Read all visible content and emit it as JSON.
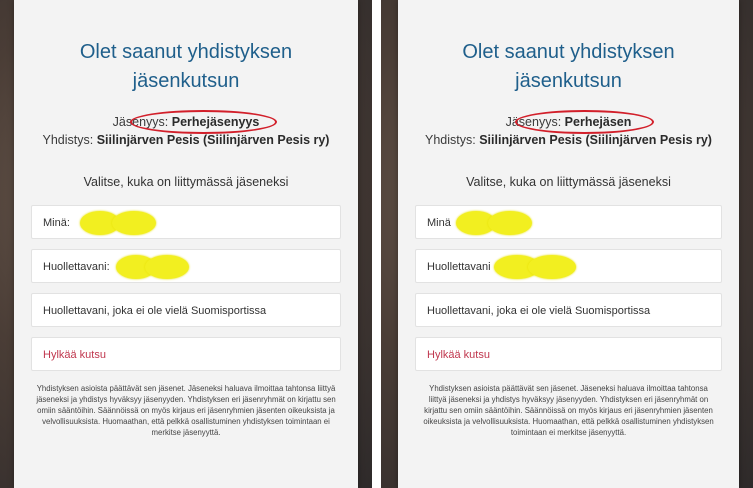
{
  "panels": [
    {
      "title_line1": "Olet saanut yhdistyksen",
      "title_line2": "jäsenkutsun",
      "membership_label": "Jäsenyys:",
      "membership_value": "Perhejäsenyys",
      "association_label": "Yhdistys:",
      "association_value": "Siilinjärven Pesis (Siilinjärven Pesis ry)",
      "prompt": "Valitse, kuka on liittymässä jäseneksi",
      "options": [
        "Minä:",
        "Huollettavani:",
        "Huollettavani, joka ei ole vielä Suomisportissa",
        "Hylkää kutsu"
      ],
      "footer": "Yhdistyksen asioista päättävät sen jäsenet. Jäseneksi haluava ilmoittaa tahtonsa liittyä jäseneksi ja yhdistys hyväksyy jäsenyyden. Yhdistyksen eri jäsenryhmät on kirjattu sen omiin sääntöihin. Säännöissä on myös kirjaus eri jäsenryhmien jäsenten oikeuksista ja velvollisuuksista. Huomaathan, että pelkkä osallistuminen yhdistyksen toimintaan ei merkitse jäsenyyttä."
    },
    {
      "title_line1": "Olet saanut yhdistyksen",
      "title_line2": "jäsenkutsun",
      "membership_label": "Jäsenyys:",
      "membership_value": "Perhejäsen",
      "association_label": "Yhdistys:",
      "association_value": "Siilinjärven Pesis (Siilinjärven Pesis ry)",
      "prompt": "Valitse, kuka on liittymässä jäseneksi",
      "options": [
        "Minä",
        "Huollettavani",
        "Huollettavani, joka ei ole vielä Suomisportissa",
        "Hylkää kutsu"
      ],
      "footer": "Yhdistyksen asioista päättävät sen jäsenet. Jäseneksi haluava ilmoittaa tahtonsa liittyä jäseneksi ja yhdistys hyväksyy jäsenyyden. Yhdistyksen eri jäsenryhmät on kirjattu sen omiin sääntöihin. Säännöissä on myös kirjaus eri jäsenryhmien jäsenten oikeuksista ja velvollisuuksista. Huomaathan, että pelkkä osallistuminen yhdistyksen toimintaan ei merkitse jäsenyyttä."
    }
  ],
  "colors": {
    "title": "#1f5f8b",
    "reject": "#c0374e",
    "highlight_circle": "#d21f2a",
    "redaction": "#f2ef20"
  }
}
